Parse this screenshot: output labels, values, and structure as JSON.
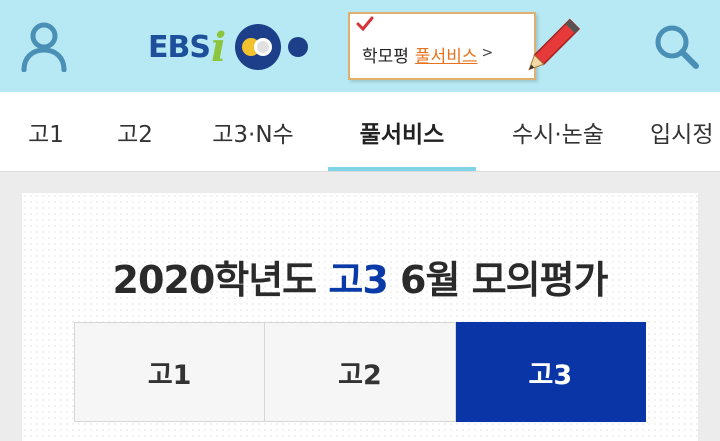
{
  "header": {
    "logo_text": "EBS",
    "logo_i": "i",
    "banner_prefix": "학모평",
    "banner_link": "풀서비스",
    "banner_arrow": ">",
    "icons": [
      "user-icon",
      "search-icon",
      "pencil-icon",
      "check-icon"
    ],
    "colors": {
      "header_bg": "#b7e9f4",
      "logo_blue": "#1d4f9a",
      "logo_green": "#8cc63f",
      "banner_link": "#e8721d"
    }
  },
  "tabs": [
    {
      "label": "고1"
    },
    {
      "label": "고2"
    },
    {
      "label": "고3·N수"
    },
    {
      "label": "풀서비스",
      "active": true
    },
    {
      "label": "수시·논술"
    },
    {
      "label": "입시정"
    }
  ],
  "exam": {
    "title_prefix": "2020학년도 ",
    "title_highlight": "고3",
    "title_suffix": " 6월 모의평가",
    "grades": [
      {
        "label": "고1"
      },
      {
        "label": "고2"
      },
      {
        "label": "고3",
        "active": true
      }
    ],
    "colors": {
      "accent": "#0a35a6",
      "tab_underline": "#7fd5e6"
    }
  }
}
